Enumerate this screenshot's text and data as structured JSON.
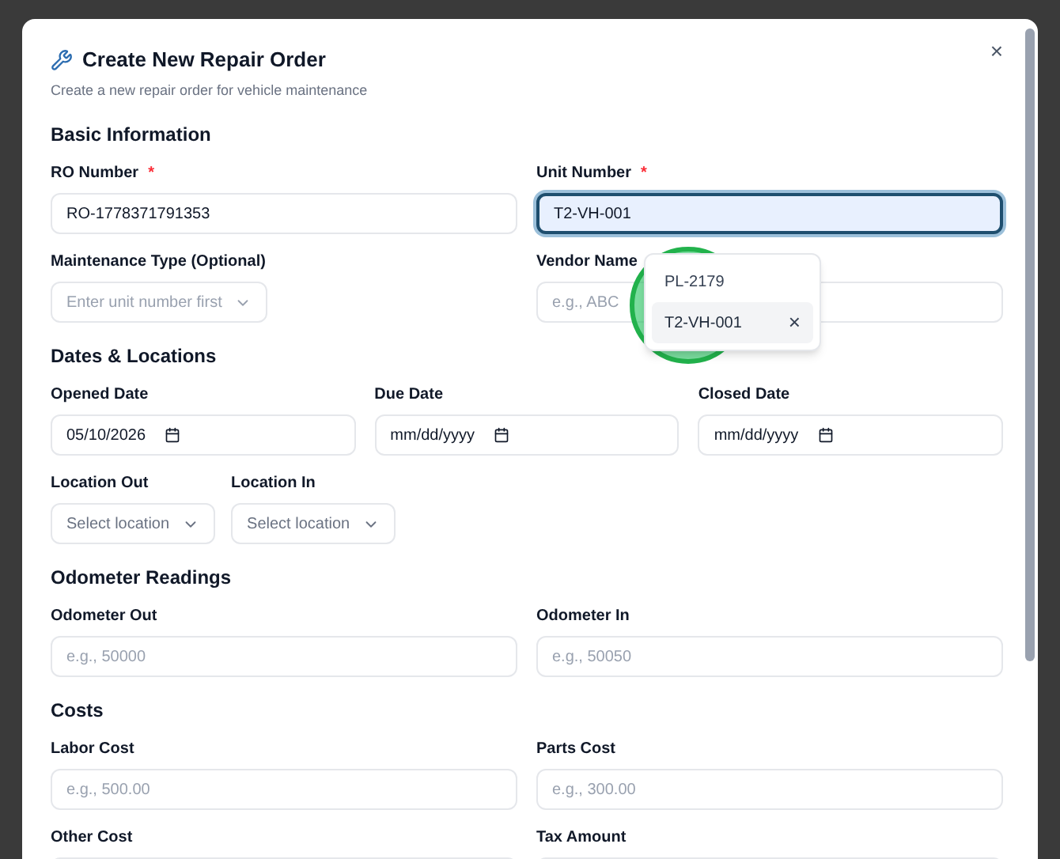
{
  "dialog": {
    "title": "Create New Repair Order",
    "subtitle": "Create a new repair order for vehicle maintenance",
    "close": "×"
  },
  "sections": [
    {
      "title": "Basic Information",
      "rows": [
        {
          "kind": "two",
          "fields": [
            {
              "kind": "text",
              "label": "RO Number",
              "asterisk": "*",
              "value": "RO-1778371791353",
              "focused": false
            },
            {
              "kind": "text",
              "label": "Unit Number",
              "asterisk": "*",
              "value": "T2-VH-001",
              "focused": true,
              "suggestions": [
                {
                  "label": "PL-2179",
                  "selected": false
                },
                {
                  "label": "T2-VH-001",
                  "selected": true,
                  "clear": "×"
                }
              ]
            }
          ]
        },
        {
          "kind": "two",
          "fields": [
            {
              "kind": "select",
              "label": "Maintenance Type (Optional)",
              "placeholder": "Enter unit number first",
              "disabled": true
            },
            {
              "kind": "text",
              "label": "Vendor Name",
              "placeholder": "e.g., ABC",
              "focused": false
            }
          ]
        }
      ]
    },
    {
      "title": "Dates & Locations",
      "rows": [
        {
          "kind": "three",
          "fields": [
            {
              "kind": "date",
              "label": "Opened Date",
              "value": "05/10/2026"
            },
            {
              "kind": "date",
              "label": "Due Date",
              "placeholder": "mm/dd/yyyy"
            },
            {
              "kind": "date",
              "label": "Closed Date",
              "placeholder": "mm/dd/yyyy"
            }
          ]
        },
        {
          "kind": "inline",
          "fields": [
            {
              "kind": "select",
              "label": "Location Out",
              "placeholder": "Select location",
              "disabled": false
            },
            {
              "kind": "select",
              "label": "Location In",
              "placeholder": "Select location",
              "disabled": false
            }
          ]
        }
      ]
    },
    {
      "title": "Odometer Readings",
      "rows": [
        {
          "kind": "two",
          "fields": [
            {
              "kind": "text",
              "label": "Odometer Out",
              "placeholder": "e.g., 50000",
              "focused": false
            },
            {
              "kind": "text",
              "label": "Odometer In",
              "placeholder": "e.g., 50050",
              "focused": false
            }
          ]
        }
      ]
    },
    {
      "title": "Costs",
      "rows": [
        {
          "kind": "two",
          "fields": [
            {
              "kind": "text",
              "label": "Labor Cost",
              "placeholder": "e.g., 500.00",
              "focused": false
            },
            {
              "kind": "text",
              "label": "Parts Cost",
              "placeholder": "e.g., 300.00",
              "focused": false
            }
          ]
        },
        {
          "kind": "two",
          "fields": [
            {
              "kind": "text",
              "label": "Other Cost",
              "focused": false
            },
            {
              "kind": "text",
              "label": "Tax Amount",
              "focused": false
            }
          ]
        }
      ]
    }
  ]
}
